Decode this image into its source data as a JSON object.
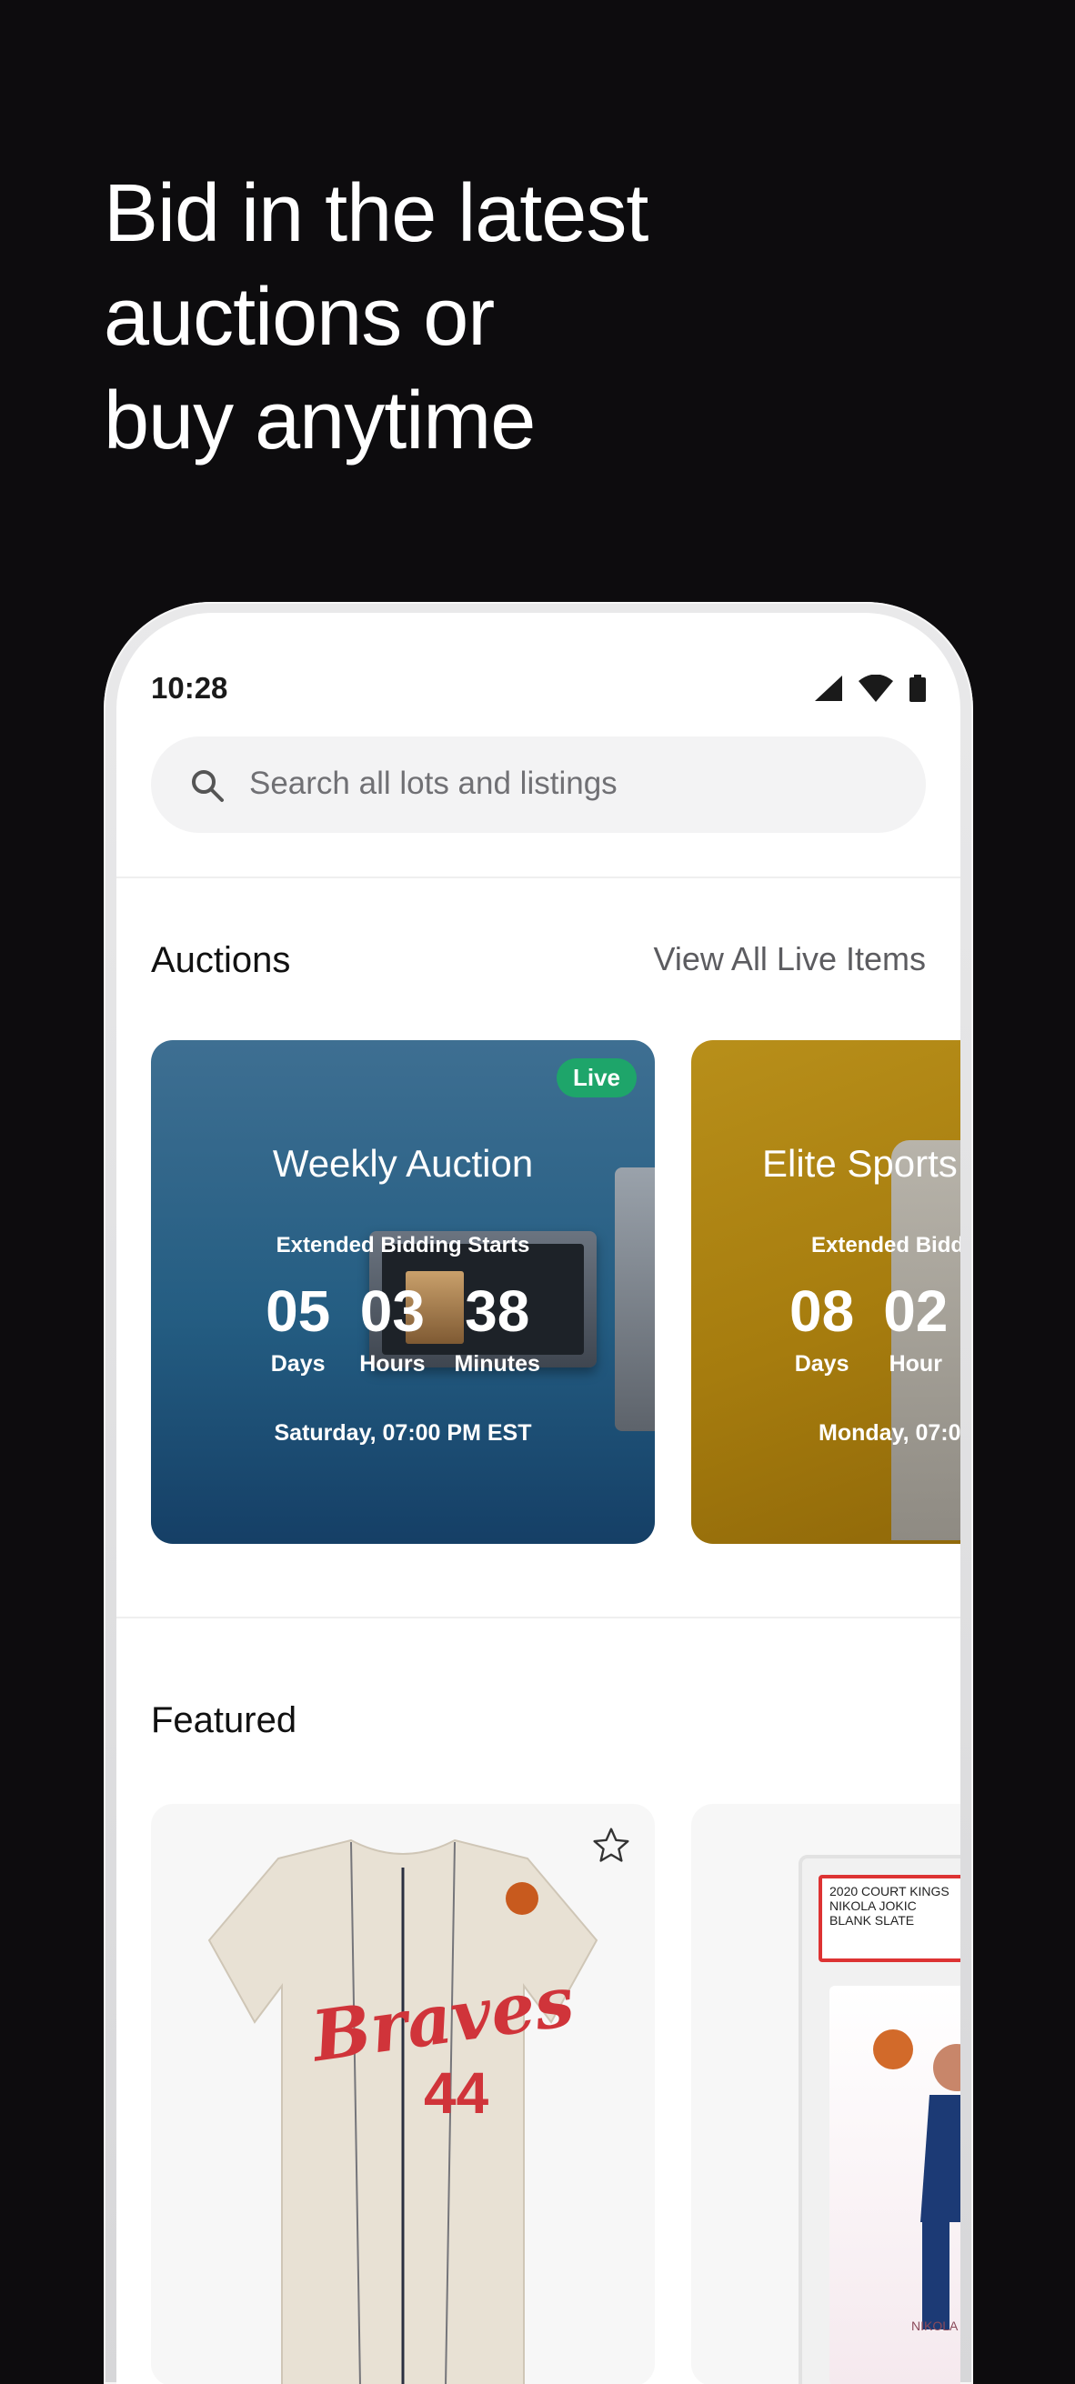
{
  "headline": {
    "lines": [
      "Bid in the latest",
      "auctions or",
      "buy anytime"
    ]
  },
  "status_bar": {
    "time": "10:28"
  },
  "search": {
    "placeholder": "Search all lots and listings"
  },
  "auctions": {
    "title": "Auctions",
    "view_all": "View All Live Items",
    "cards": [
      {
        "badge": "Live",
        "title": "Weekly Auction",
        "subtitle": "Extended Bidding Starts",
        "countdown": [
          {
            "value": "05",
            "label": "Days"
          },
          {
            "value": "03",
            "label": "Hours"
          },
          {
            "value": "38",
            "label": "Minutes"
          }
        ],
        "date": "Saturday, 07:00 PM EST"
      },
      {
        "title": "Elite Sports",
        "subtitle": "Extended Bidd",
        "countdown": [
          {
            "value": "08",
            "label": "Days"
          },
          {
            "value": "02",
            "label": "Hour"
          }
        ],
        "date": "Monday, 07:0"
      }
    ]
  },
  "featured": {
    "title": "Featured",
    "items": [
      {
        "name": "Braves 44 jersey",
        "jersey_text": "Braves",
        "jersey_number": "44"
      },
      {
        "card_label_lines": [
          "2020 COURT KINGS",
          "NIKOLA JOKIC",
          "BLANK SLATE"
        ],
        "card_caption": "NIKOLA JO"
      }
    ]
  },
  "colors": {
    "background": "#0d0c0e",
    "weekly_card": "#245d82",
    "elite_card": "#a67c0e",
    "live_badge": "#1ea56a"
  }
}
